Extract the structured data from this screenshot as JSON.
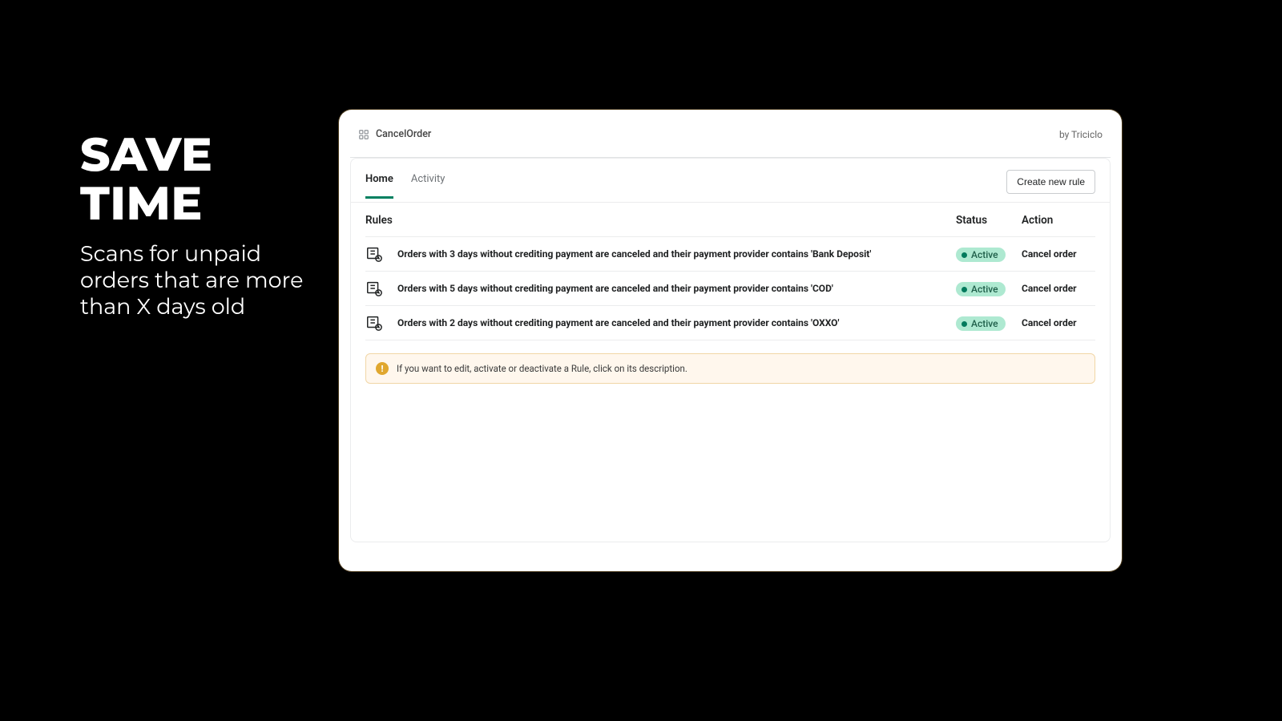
{
  "promo": {
    "headline": "SAVE TIME",
    "sub": "Scans for unpaid orders that are more than X days old"
  },
  "topbar": {
    "app_title": "CancelOrder",
    "byline": "by Triciclo"
  },
  "tabs": {
    "home": "Home",
    "activity": "Activity"
  },
  "buttons": {
    "create_new_rule": "Create new rule"
  },
  "table": {
    "headers": {
      "rules": "Rules",
      "status": "Status",
      "action": "Action"
    },
    "rows": [
      {
        "description": "Orders with 3 days without crediting payment are canceled and their payment provider contains 'Bank Deposit'",
        "status": "Active",
        "action": "Cancel order"
      },
      {
        "description": "Orders with 5 days without crediting payment are canceled and their payment provider contains 'COD'",
        "status": "Active",
        "action": "Cancel order"
      },
      {
        "description": "Orders with 2 days without crediting payment are canceled and their payment provider contains 'OXXO'",
        "status": "Active",
        "action": "Cancel order"
      }
    ]
  },
  "note": {
    "text": "If you want to edit, activate or deactivate a Rule, click on its description."
  }
}
